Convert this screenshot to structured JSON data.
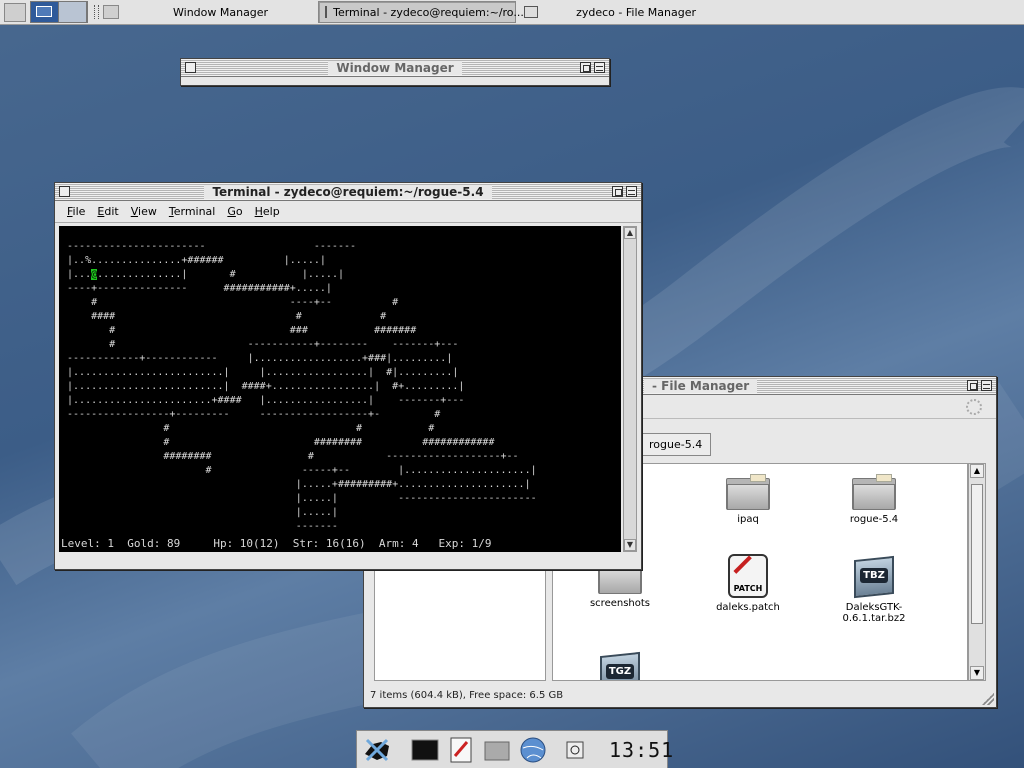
{
  "taskbar": {
    "tasks": [
      {
        "label": "Window Manager",
        "icon": "window-manager-icon",
        "active": false
      },
      {
        "label": "Terminal - zydeco@requiem:~/ro...",
        "icon": "terminal-icon",
        "active": true
      },
      {
        "label": "zydeco - File Manager",
        "icon": "file-manager-icon",
        "active": false
      }
    ]
  },
  "window_manager": {
    "title": "Window Manager"
  },
  "terminal": {
    "title": "Terminal - zydeco@requiem:~/rogue-5.4",
    "menu": [
      {
        "label": "File",
        "accel": "F"
      },
      {
        "label": "Edit",
        "accel": "E"
      },
      {
        "label": "View",
        "accel": "V"
      },
      {
        "label": "Terminal",
        "accel": "T"
      },
      {
        "label": "Go",
        "accel": "G"
      },
      {
        "label": "Help",
        "accel": "H"
      }
    ],
    "screen_before_cursor": "\n -----------------------                  -------\n |..%...............+######          |.....|\n |...",
    "cursor_char": "@",
    "screen_after_cursor": "..............|       #           |.....|\n ----+---------------      ###########+.....|\n     #                                ----+--          #\n     ####                              #             #\n        #                             ###           #######\n        #                      -----------+--------    -------+---\n ------------+------------     |..................+###|.........|\n |.........................|     |.................|  #|.........|\n |.........................|  ####+.................|  #+.........|\n |.......................+####   |.................|    -------+---\n -----------------+---------     ------------------+-         #\n                 #                               #           #\n                 #                        ########          ############\n                 ########                #            -------------------+--\n                        #               -----+--        |.....................|\n                                       |.....+#########+.....................|\n                                       |.....|          -----------------------\n                                       |.....|\n                                       -------",
    "status": "Level: 1  Gold: 89     Hp: 10(12)  Str: 16(16)  Arm: 4   Exp: 1/9"
  },
  "file_manager": {
    "title": "- File Manager",
    "path_button": "rogue-5.4",
    "items": [
      {
        "name": "ipaq",
        "kind": "folder"
      },
      {
        "name": "rogue-5.4",
        "kind": "folder"
      },
      {
        "name": "screenshots",
        "kind": "folder"
      },
      {
        "name": "daleks.patch",
        "kind": "patch"
      },
      {
        "name": "DaleksGTK-0.6.1.tar.bz2",
        "kind": "tbz"
      },
      {
        "name": "",
        "kind": "tgz"
      }
    ],
    "status": "7 items (604.4 kB), Free space: 6.5 GB"
  },
  "dock": {
    "clock": "13:51",
    "launchers": [
      "xfce-mouse-icon",
      "terminal-launcher-icon",
      "text-editor-icon",
      "file-manager-launcher-icon",
      "web-browser-icon",
      "logout-icon"
    ]
  },
  "colors": {
    "desktop": "#3c5d87",
    "cursor": "#1ec81e"
  }
}
